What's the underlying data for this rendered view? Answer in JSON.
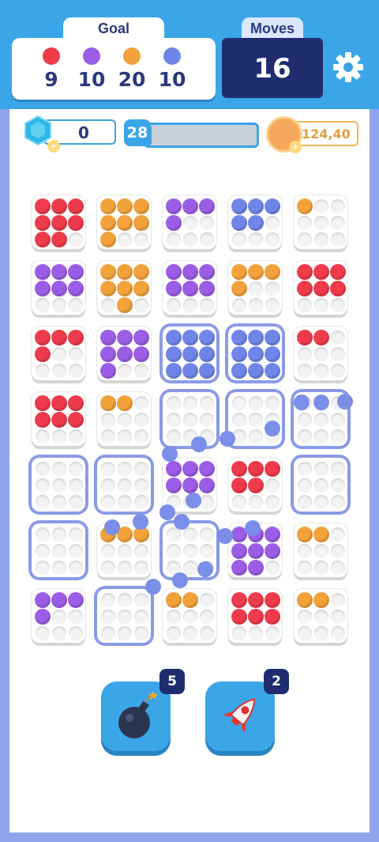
{
  "goal": {
    "label": "Goal",
    "items": [
      {
        "color": "#ee3b4b",
        "value": "9"
      },
      {
        "color": "#9b5de5",
        "value": "10"
      },
      {
        "color": "#f2a23a",
        "value": "20"
      },
      {
        "color": "#6f86e8",
        "value": "10"
      }
    ]
  },
  "moves": {
    "label": "Moves",
    "value": "16"
  },
  "resources": {
    "gems": "0",
    "level": "28",
    "level_progress": 0.05,
    "coins": "124,40"
  },
  "colors": {
    "R": "#ee3b4b",
    "P": "#9b5de5",
    "O": "#f2a23a",
    "B": "#6f86e8"
  },
  "grid": [
    [
      "RRRRRRRR.",
      "OOOOOOO..",
      "PPPP.....",
      "BBBBB....",
      "O........"
    ],
    [
      "PPPPPP...",
      "OOOOOO.O.",
      "PPPPPP...",
      "OOOO.....",
      "RRRRRR..."
    ],
    [
      "RRRR.....",
      "PPPPPPP..",
      "BBBBBBBBB",
      "BBBBBBBBB",
      "RR......."
    ],
    [
      "RRRRRR...",
      "OO.......",
      ".........",
      ".........",
      "........."
    ],
    [
      ".........",
      ".........",
      "PPPPPP...",
      "RRRRR....",
      "........."
    ],
    [
      ".........",
      "OOO......",
      ".........",
      "PPPPPPPP.",
      "OO......."
    ],
    [
      "PPPP.....",
      ".........",
      "OO.......",
      "RRRRRR...",
      "OO......."
    ]
  ],
  "selected": [
    [
      2,
      2
    ],
    [
      2,
      3
    ],
    [
      3,
      2
    ],
    [
      3,
      3
    ],
    [
      3,
      4
    ],
    [
      4,
      0
    ],
    [
      4,
      1
    ],
    [
      4,
      4
    ],
    [
      5,
      0
    ],
    [
      5,
      2
    ],
    [
      6,
      1
    ]
  ],
  "boosters": [
    {
      "name": "bomb",
      "count": "5"
    },
    {
      "name": "rocket",
      "count": "2"
    }
  ]
}
